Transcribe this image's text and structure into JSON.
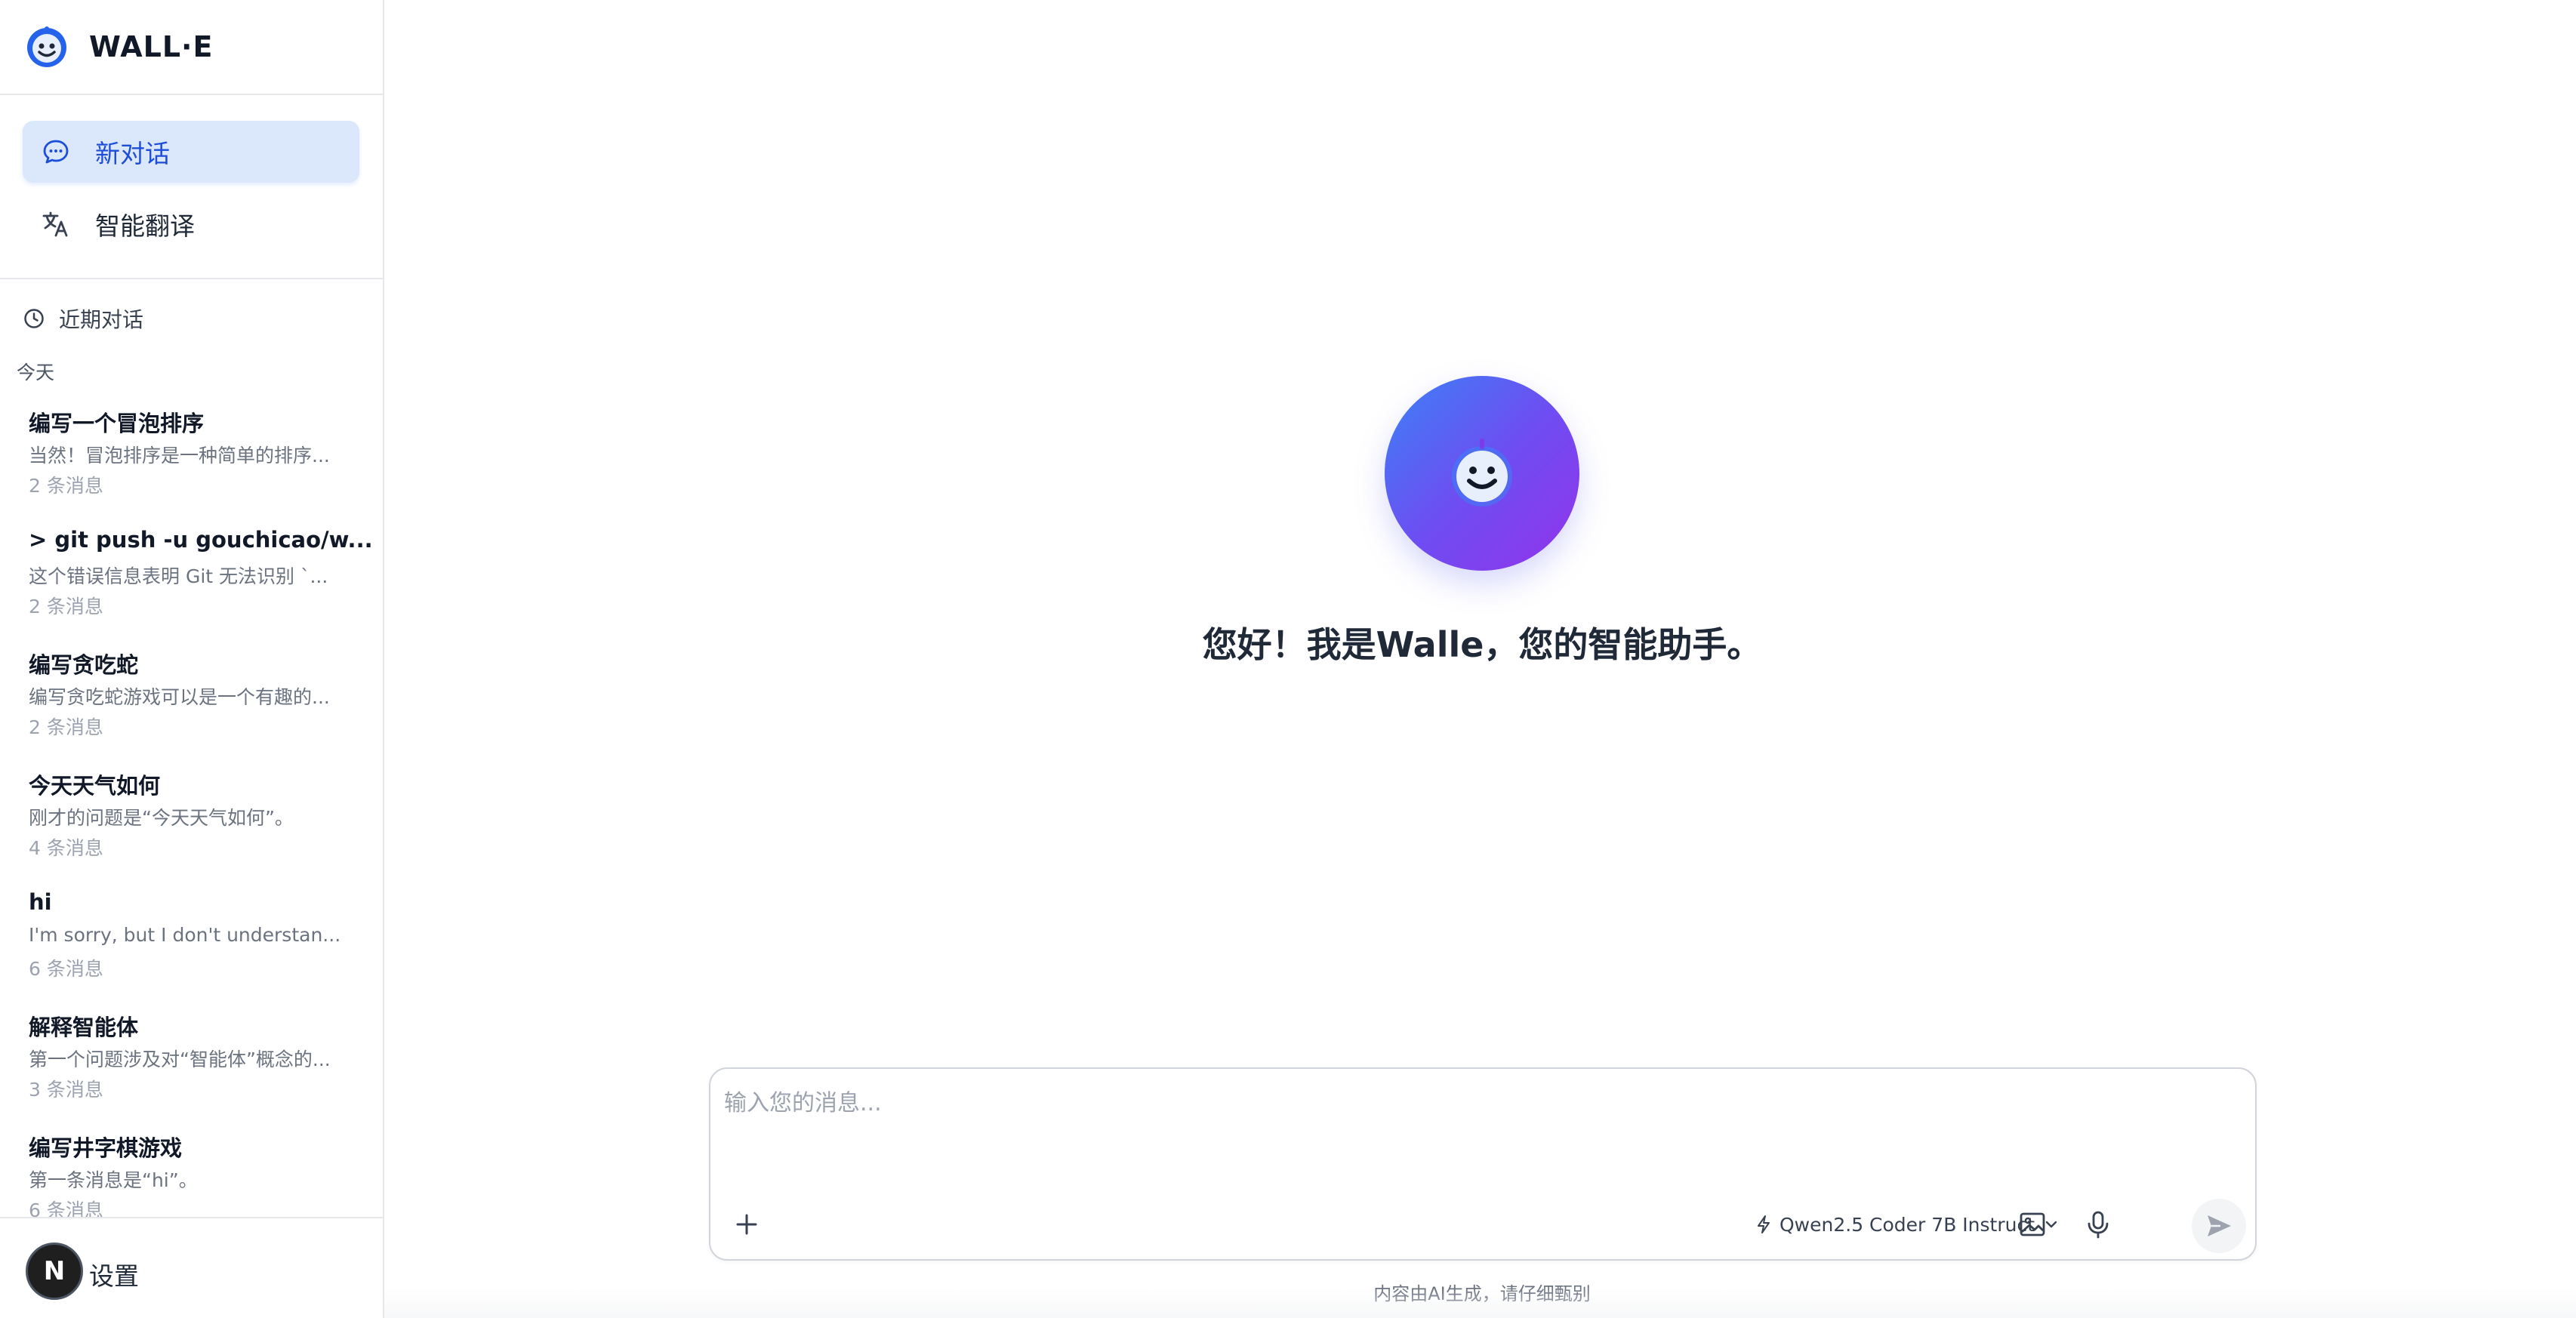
{
  "app": {
    "name": "WALL·E"
  },
  "nav": {
    "new_chat": "新对话",
    "translate": "智能翻译"
  },
  "recent": {
    "header": "近期对话",
    "group_label": "今天",
    "conversations": [
      {
        "title": "编写一个冒泡排序",
        "preview": "当然！冒泡排序是一种简单的排序...",
        "count": "2 条消息"
      },
      {
        "title": "> git push -u gouchicao/w...",
        "preview": "这个错误信息表明 Git 无法识别 `...",
        "count": "2 条消息"
      },
      {
        "title": "编写贪吃蛇",
        "preview": "编写贪吃蛇游戏可以是一个有趣的...",
        "count": "2 条消息"
      },
      {
        "title": "今天天气如何",
        "preview": "刚才的问题是“今天天气如何”。",
        "count": "4 条消息"
      },
      {
        "title": "hi",
        "preview": "I'm sorry, but I don't understan...",
        "count": "6 条消息"
      },
      {
        "title": "解释智能体",
        "preview": "第一个问题涉及对“智能体”概念的...",
        "count": "3 条消息"
      },
      {
        "title": "编写井字棋游戏",
        "preview": "第一条消息是“hi”。",
        "count": "6 条消息"
      }
    ]
  },
  "footer": {
    "avatar_letter": "N",
    "settings": "设置"
  },
  "main": {
    "greeting": "您好！我是Walle，您的智能助手。",
    "input_placeholder": "输入您的消息...",
    "input_value": "",
    "model": "Qwen2.5 Coder 7B Instruct",
    "disclaimer": "内容由AI生成，请仔细甄别"
  },
  "colors": {
    "accent": "#2563eb",
    "active_nav_bg": "#dbe7fb",
    "hero_gradient_start": "#3b82f6",
    "hero_gradient_end": "#9333ea"
  },
  "icons": {
    "logo": "robot-face-icon",
    "new_chat": "chat-bubble-icon",
    "translate": "translate-icon",
    "recent": "clock-icon",
    "attach": "plus-icon",
    "model": "lightning-icon",
    "model_dropdown": "chevron-down-icon",
    "image": "image-icon",
    "voice": "microphone-icon",
    "send": "send-icon"
  }
}
